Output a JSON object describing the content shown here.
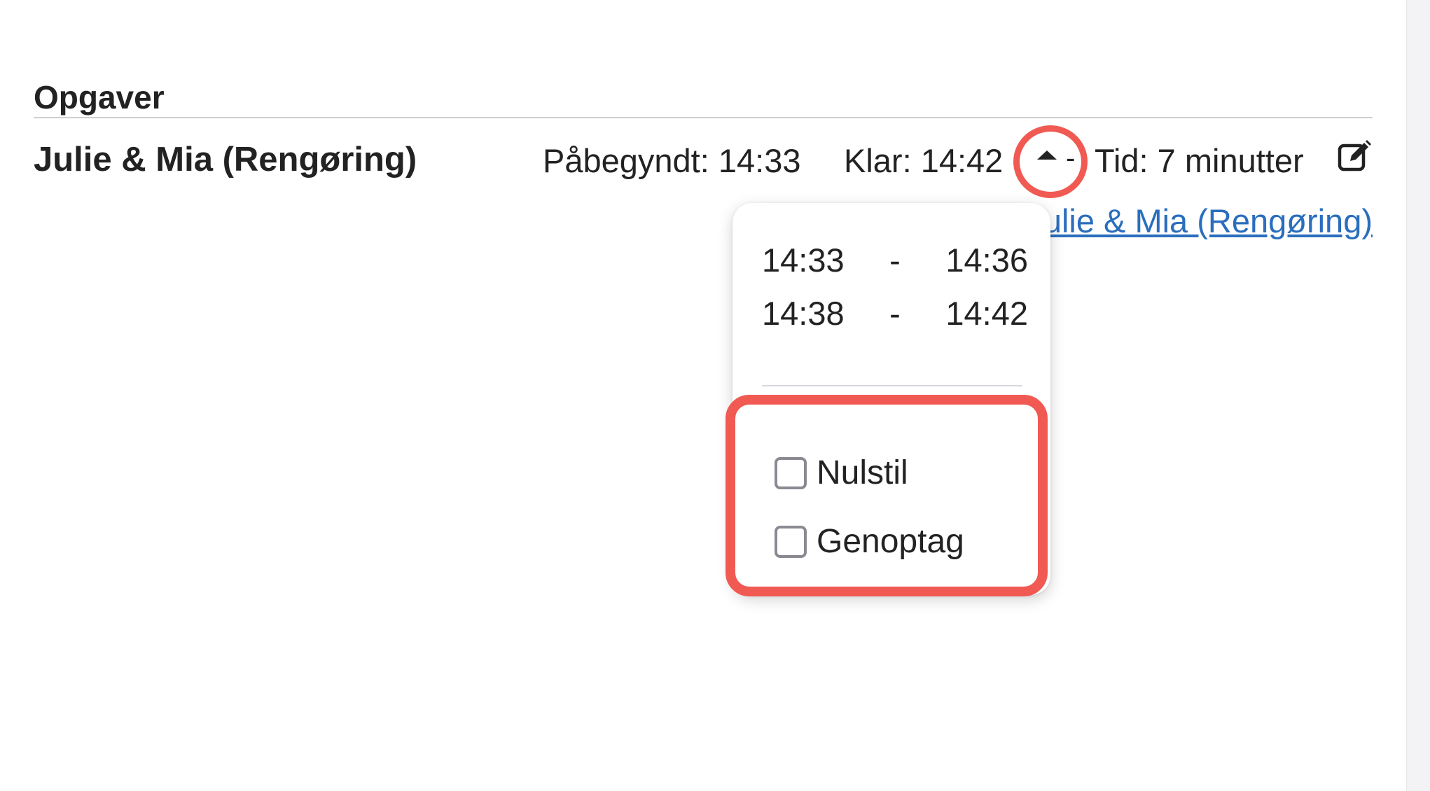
{
  "section": {
    "title": "Opgaver"
  },
  "task": {
    "name": "Julie & Mia (Rengøring)",
    "started": "Påbegyndt: 14:33",
    "ready": "Klar: 14:42",
    "separator": "-",
    "duration": "Tid: 7 minutter",
    "assignee_link": "Julie & Mia (Rengøring)"
  },
  "popover": {
    "intervals": [
      {
        "start": "14:33",
        "sep": "-",
        "end": "14:36"
      },
      {
        "start": "14:38",
        "sep": "-",
        "end": "14:42"
      }
    ],
    "options": [
      {
        "label": "Nulstil",
        "checked": false
      },
      {
        "label": "Genoptag",
        "checked": false
      }
    ]
  },
  "icons": {
    "toggle": "caret-up-icon",
    "edit": "edit-icon"
  },
  "colors": {
    "highlight": "#f05a52",
    "link": "#2a6ebd"
  }
}
